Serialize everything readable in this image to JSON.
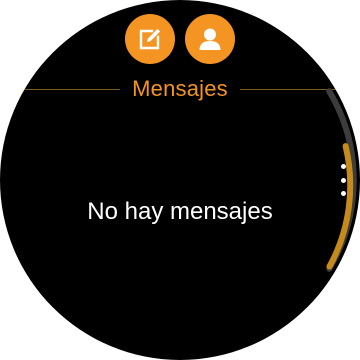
{
  "header": {
    "title": "Mensajes"
  },
  "actions": {
    "compose_icon": "compose-icon",
    "contacts_icon": "contact-icon"
  },
  "empty_state": {
    "text": "No hay mensajes"
  },
  "more_menu_icon": "more-vertical-icon",
  "colors": {
    "accent": "#f39423",
    "background": "#000000",
    "text": "#ffffff",
    "divider": "#7a5a1e"
  }
}
